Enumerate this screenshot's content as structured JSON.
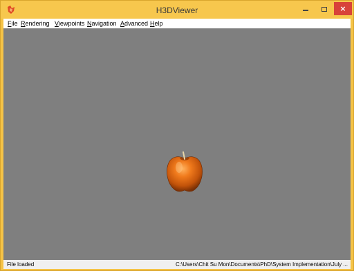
{
  "window": {
    "title": "H3DViewer",
    "app_icon": "h3d-app-icon",
    "controls": {
      "minimize_icon": "minimize-icon",
      "maximize_icon": "maximize-icon",
      "close_label": "×"
    },
    "colors": {
      "frame": "#f5c346",
      "close": "#d8433a",
      "viewport_bg": "#7f7f7f"
    }
  },
  "menu": {
    "items": [
      {
        "label": "File",
        "accel": "F",
        "rest": "ile"
      },
      {
        "label": "Rendering",
        "accel": "R",
        "rest": "endering"
      },
      {
        "label": "Viewpoints",
        "accel": "V",
        "rest": "iewpoints"
      },
      {
        "label": "Navigation",
        "accel": "N",
        "rest": "avigation"
      },
      {
        "label": "Advanced",
        "accel": "A",
        "rest": "dvanced"
      },
      {
        "label": "Help",
        "accel": "H",
        "rest": "elp"
      }
    ]
  },
  "scene": {
    "object": "apple-3d-model",
    "object_color": "#d9650e"
  },
  "status": {
    "message": "File loaded",
    "path": "C:\\Users\\Chit Su Mon\\Documents\\PhD\\System Implementation\\July ..."
  }
}
